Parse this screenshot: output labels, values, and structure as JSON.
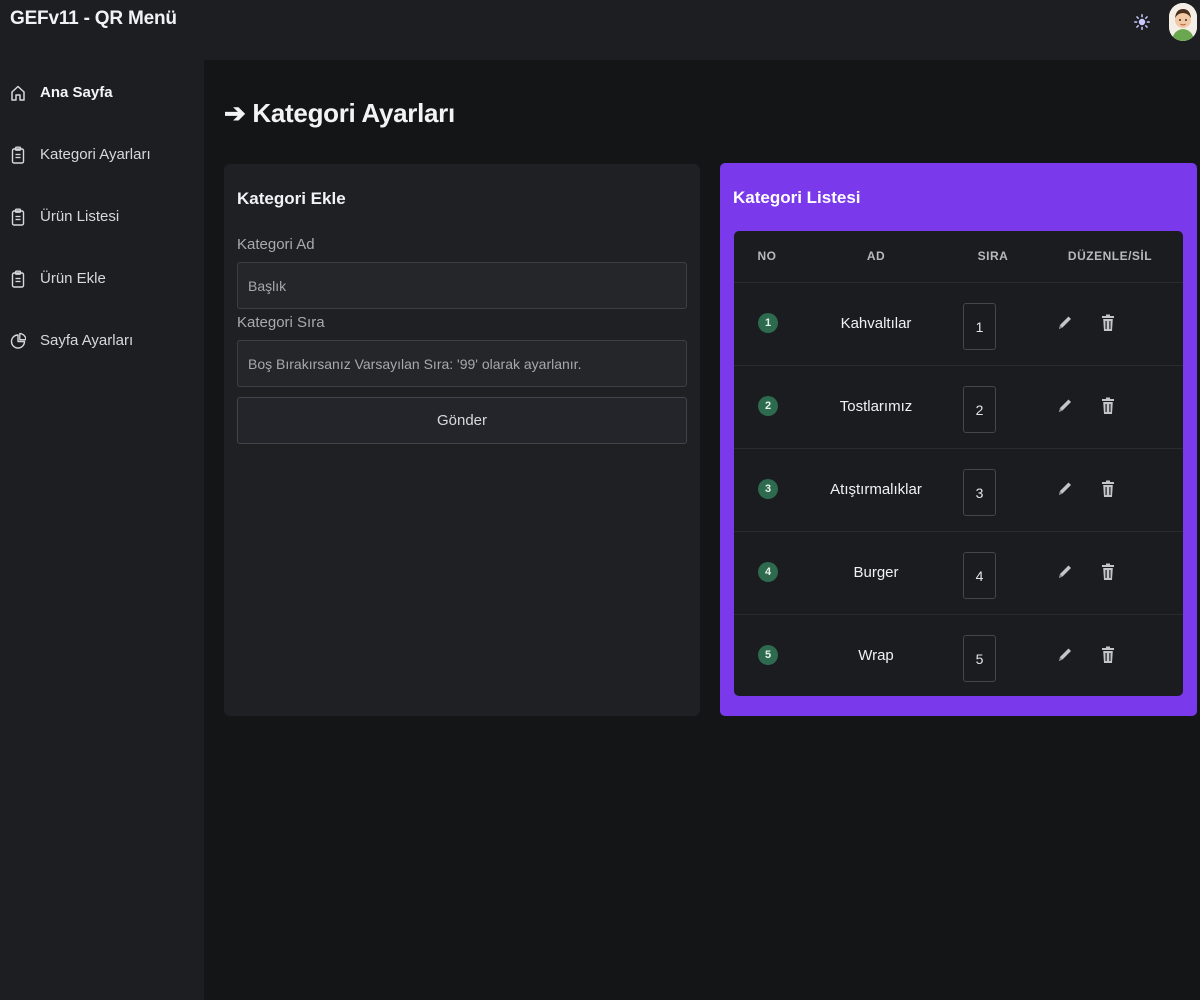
{
  "app": {
    "title": "GEFv11 - QR Menü"
  },
  "topbar": {
    "theme_icon": "sun-icon",
    "avatar_icon": "user-avatar"
  },
  "sidebar": {
    "items": [
      {
        "label": "Ana Sayfa",
        "icon": "home-icon",
        "active": true
      },
      {
        "label": "Kategori Ayarları",
        "icon": "clipboard-icon",
        "active": false
      },
      {
        "label": "Ürün Listesi",
        "icon": "clipboard-icon",
        "active": false
      },
      {
        "label": "Ürün Ekle",
        "icon": "clipboard-icon",
        "active": false
      },
      {
        "label": "Sayfa Ayarları",
        "icon": "pie-chart-icon",
        "active": false
      }
    ]
  },
  "page": {
    "title": "➔ Kategori Ayarları"
  },
  "add_form": {
    "title": "Kategori Ekle",
    "name_label": "Kategori Ad",
    "name_placeholder": "Başlık",
    "order_label": "Kategori Sıra",
    "order_placeholder": "Boş Bırakırsanız Varsayılan Sıra: '99' olarak ayarlanır.",
    "submit_label": "Gönder"
  },
  "list": {
    "title": "Kategori Listesi",
    "columns": [
      "NO",
      "AD",
      "SIRA",
      "DÜZENLE/SİL"
    ],
    "rows": [
      {
        "no": "1",
        "name": "Kahvaltılar",
        "order": "1"
      },
      {
        "no": "2",
        "name": "Tostlarımız",
        "order": "2"
      },
      {
        "no": "3",
        "name": "Atıştırmalıklar",
        "order": "3"
      },
      {
        "no": "4",
        "name": "Burger",
        "order": "4"
      },
      {
        "no": "5",
        "name": "Wrap",
        "order": "5"
      }
    ]
  },
  "colors": {
    "accent": "#7a3aeb",
    "badge": "#2e6a4e",
    "background": "#141517",
    "panel": "#1f2023"
  }
}
